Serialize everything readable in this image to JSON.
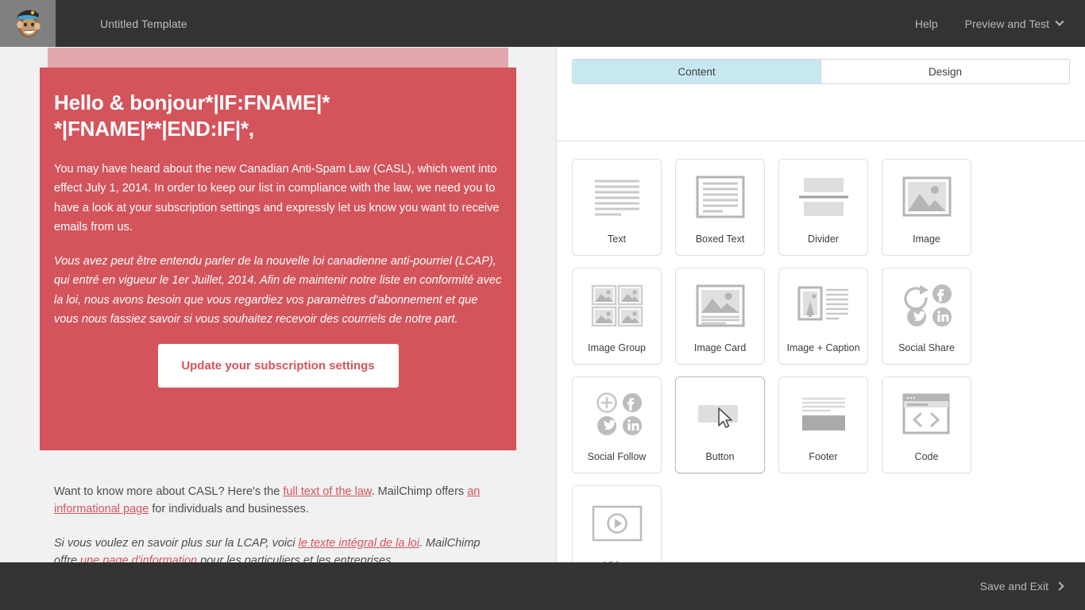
{
  "header": {
    "logo_icon": "mailchimp-freddie-logo",
    "template_title": "Untitled Template",
    "help_label": "Help",
    "preview_label": "Preview and Test",
    "chevron_icon": "chevron-down-icon"
  },
  "email": {
    "heading": "Hello & bonjour*|IF:FNAME|* *|FNAME|**|END:IF|*,",
    "paragraph_en": "You may have heard about the new Canadian Anti-Spam Law (CASL), which went into effect July 1, 2014. In order to keep our list in compliance with the law, we need you to have a look at your subscription settings and expressly let us know you want to receive emails from us.",
    "paragraph_fr": "Vous avez peut être entendu parler de la nouvelle loi canadienne anti-pourriel (LCAP), qui entré en vigueur le 1er Juillet, 2014. Afin de maintenir notre liste en conformité avec la loi, nous avons besoin que vous regardiez vos paramètres d'abonnement et que vous nous fassiez savoir si vous souhaitez recevoir des courriels de notre part.",
    "cta_label": "Update your subscription settings",
    "footnote_en": {
      "part1": "Want to know more about CASL? Here's the ",
      "link1": "full text of the law",
      "part2": ". MailChimp offers ",
      "link2": "an informational page",
      "part3": " for individuals and businesses."
    },
    "footnote_fr": {
      "part1": "Si vous voulez en savoir plus sur la LCAP, voici ",
      "link1": "le texte intégral de la loi",
      "part2": ". MailChimp offre ",
      "link2": "une page d'information",
      "part3": " pour les particuliers et les entreprises."
    },
    "colors": {
      "hero_background": "#d4545c",
      "preheader_background": "#e2a8ad",
      "canvas_background": "#f1f1f1",
      "link": "#d4545c",
      "cta_background": "#ffffff"
    }
  },
  "panel": {
    "tabs": [
      {
        "label": "Content",
        "active": true
      },
      {
        "label": "Design",
        "active": false
      }
    ],
    "active_tab_color": "#c7e8f0",
    "blocks": [
      {
        "label": "Text",
        "icon": "text-block-icon"
      },
      {
        "label": "Boxed Text",
        "icon": "boxed-text-block-icon"
      },
      {
        "label": "Divider",
        "icon": "divider-block-icon"
      },
      {
        "label": "Image",
        "icon": "image-block-icon"
      },
      {
        "label": "Image Group",
        "icon": "image-group-block-icon"
      },
      {
        "label": "Image Card",
        "icon": "image-card-block-icon"
      },
      {
        "label": "Image + Caption",
        "icon": "image-caption-block-icon"
      },
      {
        "label": "Social Share",
        "icon": "social-share-block-icon"
      },
      {
        "label": "Social Follow",
        "icon": "social-follow-block-icon"
      },
      {
        "label": "Button",
        "icon": "button-block-icon",
        "highlighted": true
      },
      {
        "label": "Footer",
        "icon": "footer-block-icon"
      },
      {
        "label": "Code",
        "icon": "code-block-icon"
      },
      {
        "label": "Video",
        "icon": "video-block-icon"
      }
    ]
  },
  "footer": {
    "save_exit_label": "Save and Exit",
    "chevron_icon": "chevron-right-icon"
  }
}
